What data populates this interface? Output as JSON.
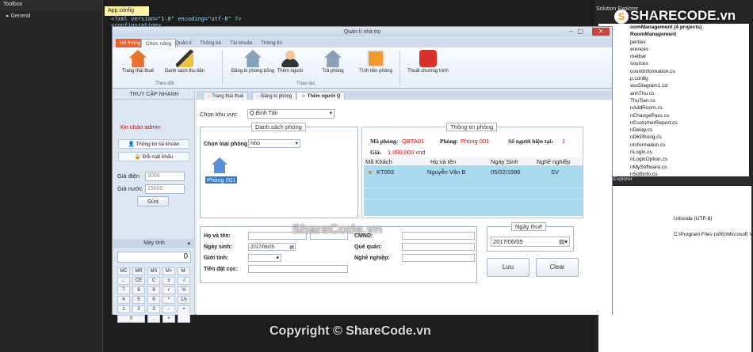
{
  "vs": {
    "toolbox_title": "Toolbox",
    "toolbox_item": "▸ General",
    "doc_tab": "App.config",
    "xml_line1": "<?xml version=\"1.0\" encoding=\"utf-8\" ?>",
    "xml_line2": "<configuration>",
    "solution_title": "Solution Explorer",
    "solution_items": [
      "oomManagement (4 projects)",
      "RoomManagement",
      "perties",
      "erences",
      "metbar",
      "sources",
      "countInformation.cs",
      "p.config",
      "assDiagram1.cd",
      "anhThu.cs",
      "ThuTien.cs",
      "nAddRoom.cs",
      "nChangePass.cs",
      "nCustomerReport.cs",
      "nDelay.cs",
      "nDKPhong.cs",
      "nInformation.cs",
      "nLogin.cs",
      "nLoginOption.cs",
      "nMySoftware.cs",
      "nSoftInfo.cs"
    ],
    "team_explorer": "Team Explorer",
    "prop_encoding": "Unicode (UTF-8)",
    "prop_path": "C:\\Program Files (x86)\\Microsoft V",
    "watermark": "SHARECODE.vn"
  },
  "app": {
    "title": "Quản lí nhà trọ",
    "tabs": [
      "Hệ thống",
      "Chức năng",
      "Quản lí",
      "Thống kê",
      "Tài khoản",
      "Thông tin"
    ],
    "ribbon": {
      "buttons": [
        "Trang thái thuê",
        "Danh sách thu tiền",
        "Đăng kí phòng trống",
        "Thêm người",
        "Trả phòng",
        "Tính tiền phòng",
        "Thoát chương trình"
      ],
      "group1": "Theo dõi",
      "group2": "Thao tác"
    },
    "left": {
      "header": "TRUY CẬP NHANH",
      "greeting": "Xin chào admin",
      "account_btn": "Thông tin tài khoản",
      "password_btn": "Đổi mật khẩu",
      "electric_label": "Giá điện",
      "electric_value": "3000",
      "water_label": "Giá nước",
      "water_value": "15000",
      "edit_btn": "Sửa",
      "calc_header": "Máy tính",
      "calc_display": "0",
      "keys": [
        "MC",
        "MR",
        "MS",
        "M+",
        "M-",
        "←",
        "CE",
        "C",
        "±",
        "√",
        "7",
        "8",
        "9",
        "/",
        "%",
        "4",
        "5",
        "6",
        "*",
        "1/x",
        "1",
        "2",
        "3",
        "-",
        "=",
        "0",
        ",",
        "+"
      ]
    },
    "doc_tabs": [
      "Trang thái thuê",
      "Đăng kí phòng",
      "Thêm người Q"
    ],
    "main": {
      "area_label": "Chọn khu vực:",
      "area_value": "Q.Bình Tân",
      "rooms_legend": "Danh sách phòng",
      "room_type_label": "Chọn loại phòng:",
      "room_type_value": "Nhỏ",
      "room_name": "Phòng 001",
      "info_legend": "Thông tin phòng",
      "room_code_label": "Mã phòng:",
      "room_code": "QBTA01",
      "room_label": "Phòng:",
      "room_value": "Phòng 001",
      "occupants_label": "Số người hiện tại:",
      "occupants": "1",
      "price_label": "Giá:",
      "price": "1,000,000 vnd",
      "columns": [
        "Mã Khách",
        "Họ và tên",
        "Ngày Sinh",
        "Nghề nghiệp"
      ],
      "rows": [
        [
          "KT003",
          "Nguyễn Văn B",
          "05/02/1996",
          "SV"
        ]
      ],
      "form": {
        "name_label": "Họ và tên:",
        "dob_label": "Ngày sinh:",
        "dob_value": "2017/06/05",
        "gender_label": "Giới tính:",
        "deposit_label": "Tiền đặt cọc:",
        "id_label": "CMND:",
        "hometown_label": "Quê quán:",
        "job_label": "Nghề nghiệp:"
      },
      "rent_legend": "Ngày thuê",
      "rent_date": "2017/06/05",
      "save_btn": "Lưu",
      "clear_btn": "Clear"
    },
    "watermark_center": "ShareCode.vn",
    "copyright": "Copyright © ShareCode.vn"
  }
}
